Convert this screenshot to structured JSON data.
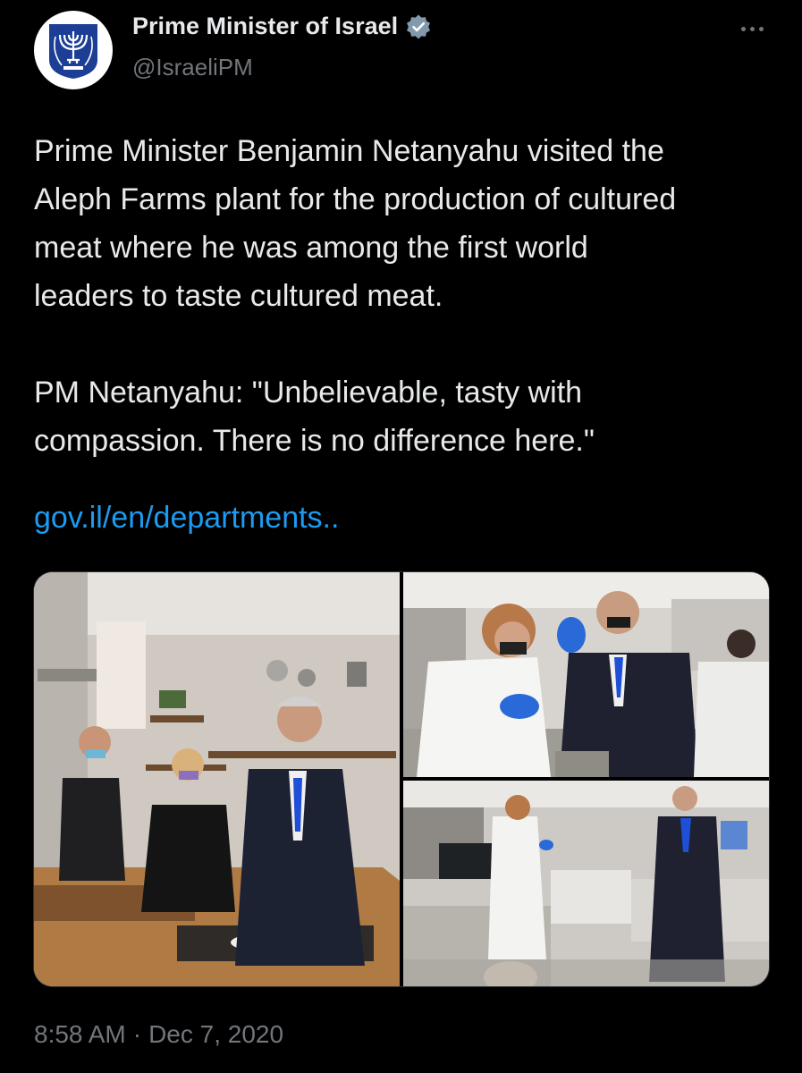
{
  "header": {
    "display_name": "Prime Minister of Israel",
    "handle": "@IsraeliPM"
  },
  "tweet": {
    "text": "Prime Minister Benjamin Netanyahu visited the\nAleph Farms plant for the production of cultured\nmeat where he was among the first world\nleaders to taste cultured meat.\n\nPM Netanyahu: \"Unbelievable, tasty with\ncompassion. There is no difference here.\"",
    "link_text": "gov.il/en/departments.."
  },
  "footer": {
    "time": "8:58 AM",
    "separator": "·",
    "date": "Dec 7, 2020"
  },
  "colors": {
    "background": "#000000",
    "text": "#e7e9ea",
    "muted": "#71767b",
    "link": "#1d9bf0",
    "verified": "#829aab",
    "emblem": "#1c3f95"
  },
  "icons": {
    "avatar": "israel-emblem-icon",
    "verified": "verified-badge-icon",
    "more": "more-options-icon"
  }
}
